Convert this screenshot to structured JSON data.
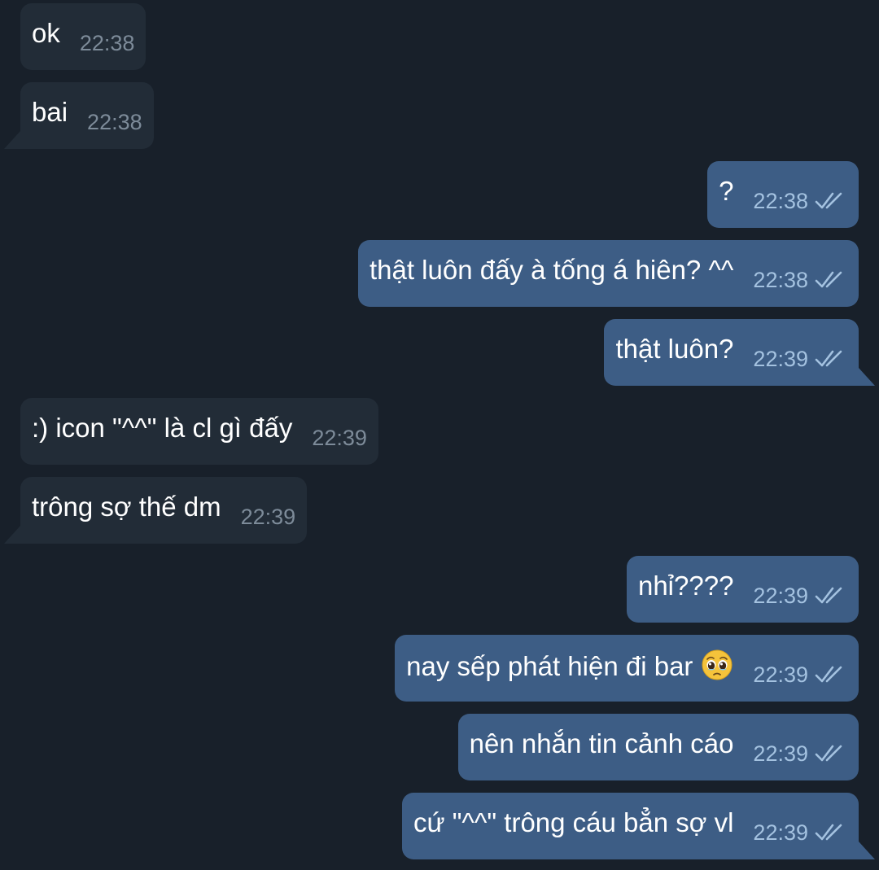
{
  "messages": [
    {
      "direction": "incoming",
      "text": "ok",
      "time": "22:38"
    },
    {
      "direction": "incoming",
      "text": "bai",
      "time": "22:38"
    },
    {
      "direction": "outgoing",
      "text": "?",
      "time": "22:38",
      "status": "double-check-icon"
    },
    {
      "direction": "outgoing",
      "text": "thật luôn đấy à tống á hiên? ^^",
      "time": "22:38",
      "status": "double-check-icon"
    },
    {
      "direction": "outgoing",
      "text": "thật luôn?",
      "time": "22:39",
      "status": "double-check-icon"
    },
    {
      "direction": "incoming",
      "text": ":) icon \"^^\" là cl gì đấy",
      "time": "22:39"
    },
    {
      "direction": "incoming",
      "text": "trông sợ thế dm",
      "time": "22:39"
    },
    {
      "direction": "outgoing",
      "text": "nhỉ????",
      "time": "22:39",
      "status": "double-check-icon"
    },
    {
      "direction": "outgoing",
      "text": "nay sếp phát hiện đi bar",
      "emoji": "pleading-face-icon",
      "time": "22:39",
      "status": "double-check-icon"
    },
    {
      "direction": "outgoing",
      "text": "nên nhắn tin cảnh cáo",
      "time": "22:39",
      "status": "double-check-icon"
    },
    {
      "direction": "outgoing",
      "text": "cứ \"^^\" trông cáu bẳn sợ vl",
      "time": "22:39",
      "status": "double-check-icon"
    }
  ],
  "colors": {
    "background": "#18202a",
    "incoming_bubble": "#222c37",
    "outgoing_bubble": "#3d5d85",
    "incoming_time": "#7d8b99",
    "outgoing_time": "#a4c2e0"
  }
}
